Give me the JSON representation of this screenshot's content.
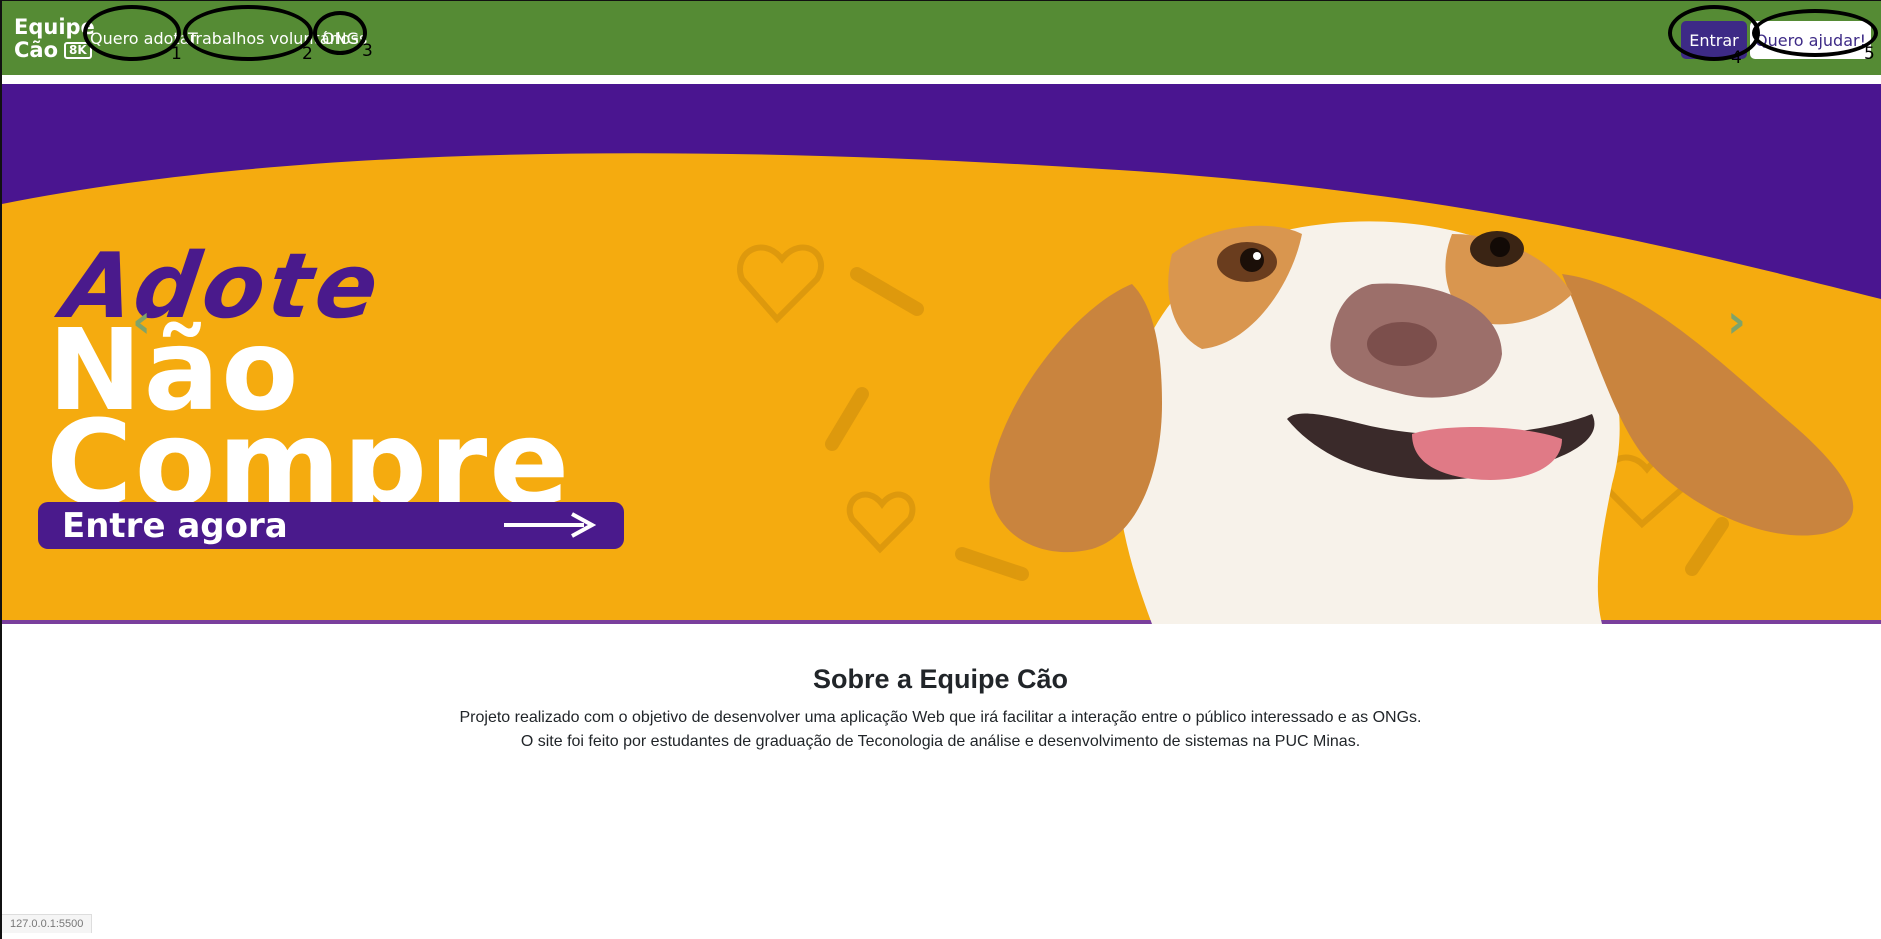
{
  "navbar": {
    "brand_line1": "Equipe",
    "brand_line2": "Cão",
    "brand_badge": "8K",
    "links": [
      {
        "label": "Quero adotar",
        "annotation": "1"
      },
      {
        "label": "Trabalhos voluntários",
        "annotation": "2"
      },
      {
        "label": "ONGs",
        "annotation": "3"
      }
    ],
    "login_label": "Entrar",
    "login_annotation": "4",
    "help_label": "Quero ajudar!",
    "help_annotation": "5"
  },
  "hero": {
    "line1": "Adote",
    "line2": "Não",
    "line3": "Compre",
    "cta_label": "Entre agora",
    "prev_arrow": "‹",
    "next_arrow": "›"
  },
  "about": {
    "title": "Sobre a Equipe Cão",
    "line1": "Projeto realizado com o objetivo de desenvolver uma aplicação Web que irá facilitar a interação entre o público interessado e as ONGs.",
    "line2": "O site foi feito por estudantes de graduação de Teconologia de análise e desenvolvimento de sistemas na PUC Minas."
  },
  "status_bar": {
    "url": "127.0.0.1:5500"
  },
  "colors": {
    "navbar": "#558b34",
    "purple": "#4a1a8c",
    "button_purple": "#3d2a86",
    "yellow": "#f5ab0f"
  }
}
